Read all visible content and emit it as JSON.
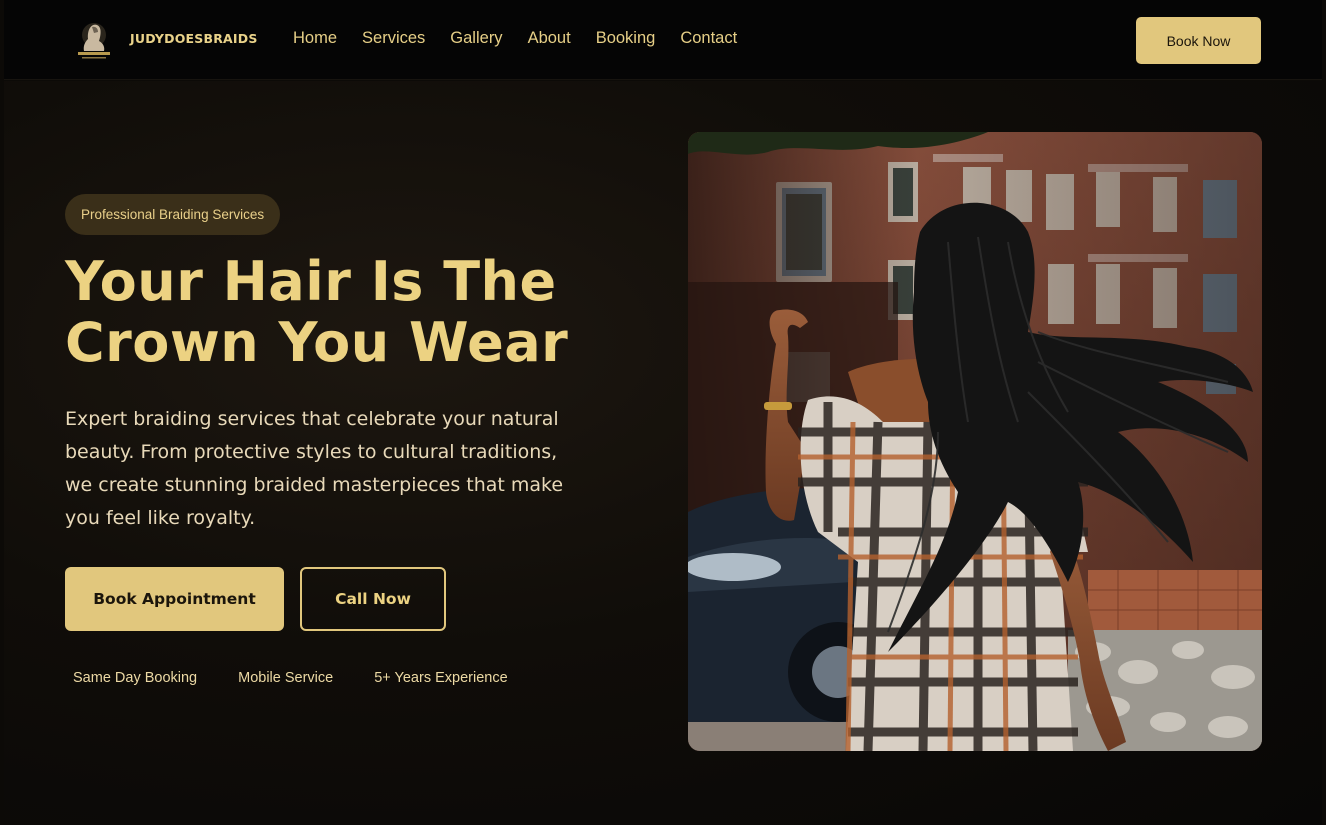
{
  "nav": {
    "brand": "JUDYDOESBRAIDS",
    "links": [
      "Home",
      "Services",
      "Gallery",
      "About",
      "Booking",
      "Contact"
    ],
    "book_button": "Book Now"
  },
  "hero": {
    "badge": "Professional Braiding Services",
    "headline_line1": "Your Hair Is The",
    "headline_line2": "Crown You Wear",
    "description": "Expert braiding services that celebrate your natural beauty. From protective styles to cultural traditions, we create stunning braided masterpieces that make you feel like royalty.",
    "primary_button": "Book Appointment",
    "secondary_button": "Call Now",
    "features": [
      "Same Day Booking",
      "Mobile Service",
      "5+ Years Experience"
    ]
  },
  "colors": {
    "accent_gold": "#e1c77d",
    "headline_gold": "#ecd282",
    "background": "#0c0a07",
    "nav_background": "#050505"
  }
}
